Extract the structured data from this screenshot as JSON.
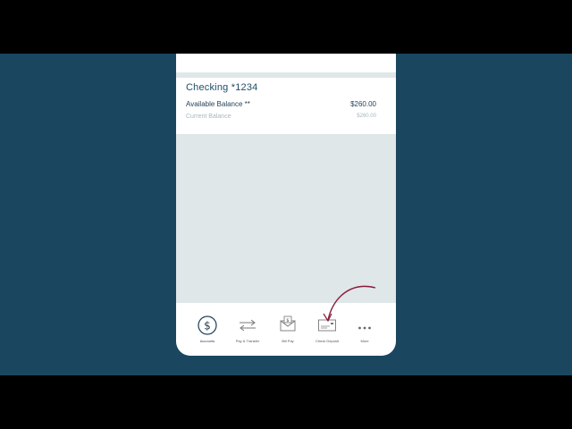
{
  "account": {
    "name": "Checking *1234",
    "available_label": "Available Balance **",
    "available_value": "$260.00",
    "current_label": "Current Balance",
    "current_value": "$260.00"
  },
  "tabbar": {
    "tabs": [
      {
        "label": "Accounts",
        "icon": "dollar-circle-icon",
        "active": true
      },
      {
        "label": "Pay & Transfer",
        "icon": "transfer-arrows-icon",
        "active": false
      },
      {
        "label": "Bill Pay",
        "icon": "envelope-dollar-icon",
        "active": false
      },
      {
        "label": "Check Deposit",
        "icon": "check-icon",
        "active": false
      },
      {
        "label": "More",
        "icon": "more-dots-icon",
        "active": false
      }
    ]
  },
  "colors": {
    "background": "#1a4660",
    "accent": "#8a1c3a",
    "text_dark": "#1f3e55",
    "muted": "#a7b7bf"
  }
}
